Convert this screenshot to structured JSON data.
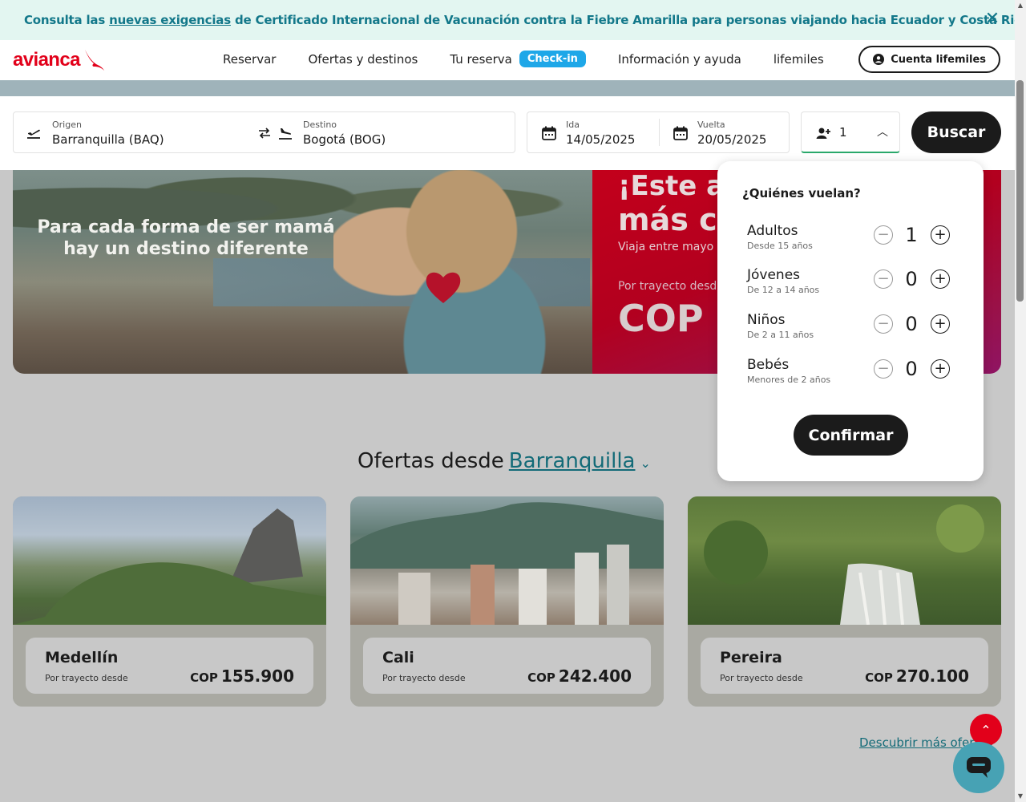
{
  "alert": {
    "text_before": "Consulta las",
    "link": "nuevas exigencias",
    "text_after": "de Certificado Internacional de Vacunación contra la Fiebre Amarilla para personas viajando hacia Ecuador y Costa Rica."
  },
  "header": {
    "logo_text": "avianca",
    "nav": {
      "reservar": "Reservar",
      "ofertas": "Ofertas y destinos",
      "tu_reserva": "Tu reserva",
      "checkin": "Check-in",
      "info": "Información y ayuda",
      "lifemiles": "lifemiles"
    },
    "account_label": "Cuenta lifemiles"
  },
  "search": {
    "origin_label": "Origen",
    "origin_value": "Barranquilla  (BAQ)",
    "destination_label": "Destino",
    "destination_value": "Bogotá  (BOG)",
    "depart_label": "Ida",
    "depart_value": "14/05/2025",
    "return_label": "Vuelta",
    "return_value": "20/05/2025",
    "passengers": "1",
    "search_button": "Buscar"
  },
  "hero": {
    "caption": "Para cada forma de ser mamá hay un destino diferente",
    "promo_line1": "¡Este añ",
    "promo_line2": "más co",
    "promo_line3": "Viaja entre mayo y",
    "promo_line4": "Por trayecto desd",
    "promo_line5": "COP"
  },
  "passengers_popup": {
    "title": "¿Quiénes vuelan?",
    "rows": [
      {
        "name": "Adultos",
        "sub": "Desde 15 años",
        "count": "1"
      },
      {
        "name": "Jóvenes",
        "sub": "De 12 a 14 años",
        "count": "0"
      },
      {
        "name": "Niños",
        "sub": "De 2 a 11 años",
        "count": "0"
      },
      {
        "name": "Bebés",
        "sub": "Menores de 2 años",
        "count": "0"
      }
    ],
    "confirm": "Confirmar"
  },
  "offers": {
    "title": "Ofertas desde",
    "city": "Barranquilla",
    "cards": [
      {
        "city": "Medellín",
        "from": "Por trayecto desde",
        "currency": "COP",
        "price": "155.900"
      },
      {
        "city": "Cali",
        "from": "Por trayecto desde",
        "currency": "COP",
        "price": "242.400"
      },
      {
        "city": "Pereira",
        "from": "Por trayecto desde",
        "currency": "COP",
        "price": "270.100"
      }
    ],
    "more_link": "Descubrir más ofertas"
  },
  "colors": {
    "brand_red": "#e2001a",
    "checkin_blue": "#1ea7e8",
    "link_teal": "#136b78",
    "alert_bg": "#e3f6f1"
  },
  "icons": [
    "warning-icon",
    "close-icon",
    "avianca-bird-icon",
    "user-icon",
    "plane-takeoff-icon",
    "swap-icon",
    "plane-landing-icon",
    "calendar-icon",
    "add-user-icon",
    "chevron-up-icon",
    "minus-icon",
    "plus-icon",
    "chevron-down-icon",
    "arrow-up-icon",
    "chat-icon"
  ]
}
